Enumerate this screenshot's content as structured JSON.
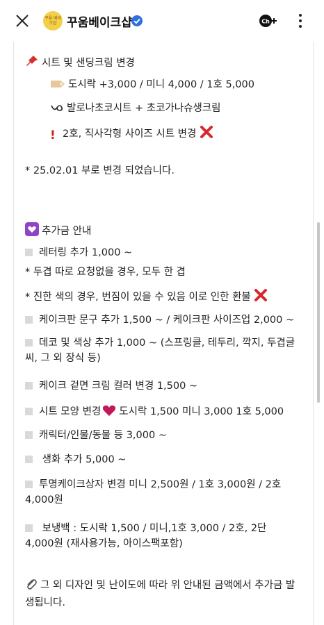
{
  "header": {
    "title": "꾸움베이크샵",
    "avatar_text": "꾸움 베이크샵"
  },
  "content": {
    "section1_title": "시트 및 샌딩크림 변경",
    "s1_line1": "도시락 +3,000 / 미니  4,000 / 1호 5,000",
    "s1_line2": "발로나초코시트 + 초코가나슈생크림",
    "s1_line3": "2호, 직사각형 사이즈 시트 변경",
    "note_date": "* 25.02.01 부로 변경 되었습니다.",
    "section2_title": "추가금 안내",
    "lettering": "레터링 추가 1,000 ~",
    "lettering_note1": "* 두겹 따로 요청없을 경우, 모두 한 겹",
    "lettering_note2": "* 진한 색의 경우, 번짐이 있을 수 있음 이로 인한 환불",
    "cakeboard": "케이크판 문구 추가 1,500 ~ / 케이크판 사이즈업 2,000 ~",
    "deco": "데코 및 색상 추가 1,000 ~ (스프링클, 테두리, 깍지, 두겹글씨, 그 외 장식 등)",
    "cream_color": "케이크 겉면 크림 컬러 변경 1,500 ~",
    "sheet_shape_a": "시트 모양 변경",
    "sheet_shape_b": "도시락 1,500 미니 3,000 1호 5,000",
    "character": "캐릭터/인물/동물 등  3,000 ~",
    "flower": " 생화 추가 5,000 ~",
    "clear_box": "투명케이크상자 변경 미니 2,500원 / 1호 3,000원 / 2호 4,000원",
    "cooler": " 보냉백 : 도시락 1,500 / 미니,1호 3,000 / 2호, 2단 4,000원 (재사용가능, 아이스팩포함)",
    "footer_note": "그 외 디자인 및 난이도에 따라 위 안내된 금액에서 추가금 발생됩니다."
  }
}
